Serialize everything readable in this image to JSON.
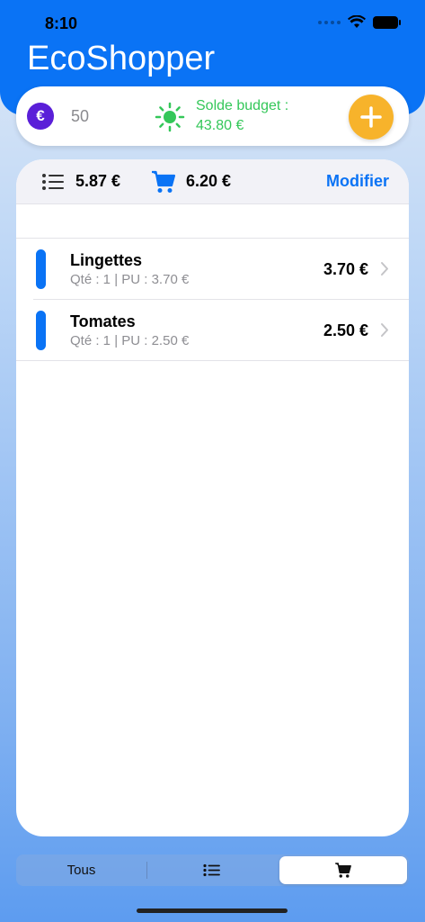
{
  "status_bar": {
    "time": "8:10"
  },
  "app": {
    "title": "EcoShopper"
  },
  "budget": {
    "currency_symbol": "€",
    "value": "50",
    "solde_label": "Solde budget :",
    "solde_value": "43.80 €",
    "add_icon": "plus-icon"
  },
  "totals": {
    "list_total": "5.87 €",
    "cart_total": "6.20 €",
    "modify_label": "Modifier"
  },
  "items": [
    {
      "name": "Lingettes",
      "detail": "Qté : 1  |  PU : 3.70 €",
      "price": "3.70 €"
    },
    {
      "name": "Tomates",
      "detail": "Qté : 1  |  PU : 2.50 €",
      "price": "2.50 €"
    }
  ],
  "segments": {
    "all_label": "Tous",
    "selected": "cart"
  },
  "colors": {
    "accent": "#0a73f5",
    "add_button": "#f7b32b",
    "euro_badge": "#5a1fd8",
    "solde": "#34c759"
  }
}
